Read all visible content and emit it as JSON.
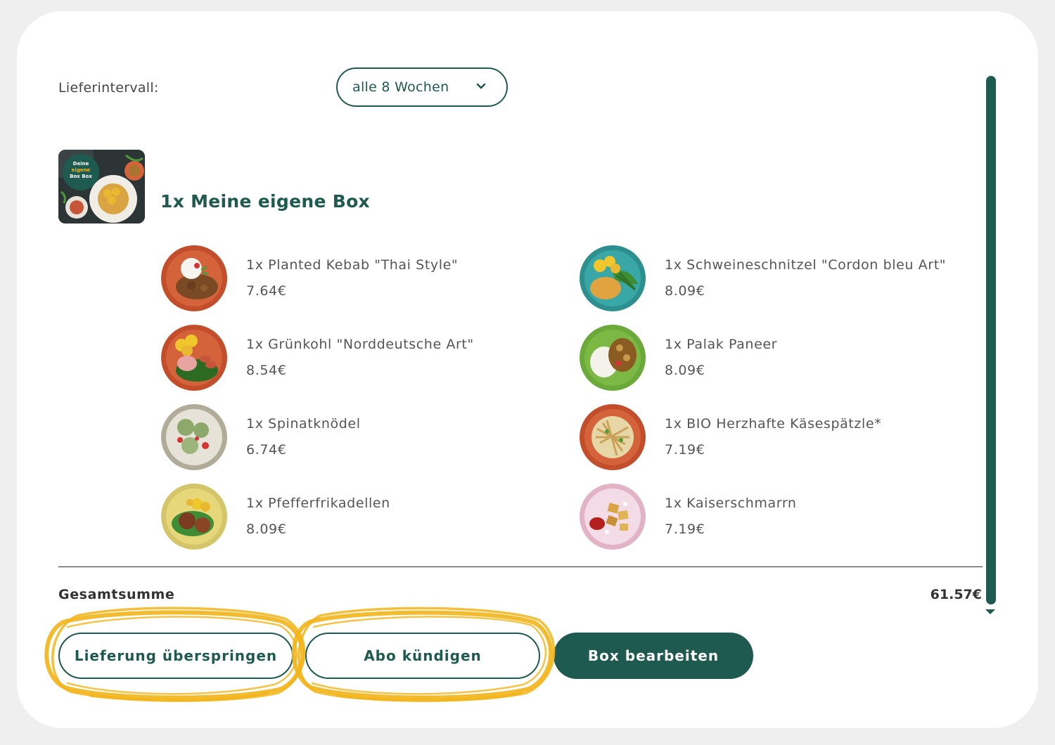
{
  "delivery": {
    "interval_label": "Lieferintervall:",
    "interval_value": "alle 8 Wochen"
  },
  "box": {
    "title": "1x Meine eigene Box",
    "thumb_text": [
      "Deine",
      "eigene",
      "Box Box"
    ]
  },
  "items": [
    {
      "name": "1x Planted Kebab \"Thai Style\"",
      "price": "7.64€",
      "plate_color": "#d4623a",
      "food": "rice-meat"
    },
    {
      "name": "1x Schweineschnitzel \"Cordon bleu Art\"",
      "price": "8.09€",
      "plate_color": "#3aa7a7",
      "food": "schnitzel"
    },
    {
      "name": "1x Grünkohl \"Norddeutsche Art\"",
      "price": "8.54€",
      "plate_color": "#d4623a",
      "food": "kale"
    },
    {
      "name": "1x Palak Paneer",
      "price": "8.09€",
      "plate_color": "#7cb944",
      "food": "rice-curry"
    },
    {
      "name": "1x Spinatknödel",
      "price": "6.74€",
      "plate_color": "#c9c4b4",
      "food": "dumplings"
    },
    {
      "name": "1x BIO Herzhafte Käsespätzle*",
      "price": "7.19€",
      "plate_color": "#d4623a",
      "food": "spaetzle"
    },
    {
      "name": "1x Pfefferfrikadellen",
      "price": "8.09€",
      "plate_color": "#e6d77a",
      "food": "meatballs"
    },
    {
      "name": "1x Kaiserschmarrn",
      "price": "7.19€",
      "plate_color": "#eec7d6",
      "food": "schmarrn"
    }
  ],
  "summary": {
    "total_label": "Gesamtsumme",
    "total_value": "61.57€"
  },
  "actions": {
    "skip_label": "Lieferung überspringen",
    "cancel_label": "Abo kündigen",
    "edit_label": "Box bearbeiten"
  },
  "colors": {
    "brand": "#1e5a4f",
    "highlight": "#f2b418"
  }
}
